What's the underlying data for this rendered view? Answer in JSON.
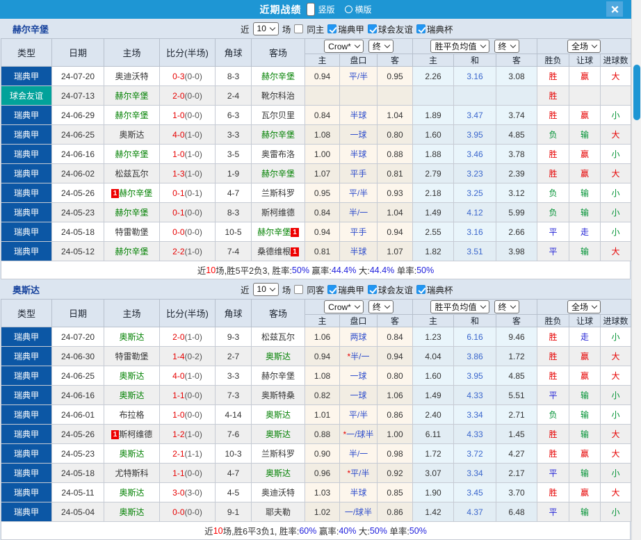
{
  "titlebar": {
    "title": "近期战绩",
    "options": [
      {
        "label": "竖版",
        "selected": true
      },
      {
        "label": "横版",
        "selected": false
      }
    ]
  },
  "colors": {
    "accent_blue": "#1e96d4",
    "league_blue": "#0c57a5",
    "friendly_teal": "#02a29a",
    "win_red": "#e60000",
    "lose_green": "#009233",
    "draw_blue": "#2323d6",
    "focus_team_green": "#008000",
    "handicap_blue": "#2f4ecc"
  },
  "table_header": {
    "main_cols": [
      "类型",
      "日期",
      "主场",
      "比分(半场)",
      "角球",
      "客场"
    ],
    "odds_source_select": "Crow*",
    "odds_final_select": "终",
    "avg_source_select": "胜平负均值",
    "avg_final_select": "终",
    "result_scope_select": "全场",
    "sub_cols": [
      "主",
      "盘口",
      "客",
      "主",
      "和",
      "客",
      "胜负",
      "让球",
      "进球数"
    ]
  },
  "sections": [
    {
      "team": "赫尔辛堡",
      "filter": {
        "near": "近",
        "count": "10",
        "games": "场",
        "same": {
          "label": "同主",
          "checked": false
        },
        "leagues": [
          {
            "label": "瑞典甲",
            "checked": true
          },
          {
            "label": "球会友谊",
            "checked": true
          },
          {
            "label": "瑞典杯",
            "checked": true
          }
        ]
      },
      "rows": [
        {
          "type": "瑞典甲",
          "kind": "league",
          "date": "24-07-20",
          "home": {
            "name": "奥迪沃特",
            "focus": false,
            "card": false
          },
          "score": "0-3",
          "half": "(0-0)",
          "corners": "8-3",
          "away": {
            "name": "赫尔辛堡",
            "focus": true,
            "card": false
          },
          "odds": {
            "home": "0.94",
            "handicap": "平/半",
            "away": "0.95",
            "star": false
          },
          "avg": {
            "home": "2.26",
            "draw": "3.16",
            "away": "3.08"
          },
          "result": [
            "胜",
            "赢",
            "大"
          ]
        },
        {
          "type": "球会友谊",
          "kind": "friendly",
          "date": "24-07-13",
          "home": {
            "name": "赫尔辛堡",
            "focus": true,
            "card": false
          },
          "score": "2-0",
          "half": "(0-0)",
          "corners": "2-4",
          "away": {
            "name": "靴尔科治",
            "focus": false,
            "card": false
          },
          "odds": {
            "home": "",
            "handicap": "",
            "away": "",
            "star": false
          },
          "avg": {
            "home": "",
            "draw": "",
            "away": ""
          },
          "result": [
            "胜",
            "",
            ""
          ]
        },
        {
          "type": "瑞典甲",
          "kind": "league",
          "date": "24-06-29",
          "home": {
            "name": "赫尔辛堡",
            "focus": true,
            "card": false
          },
          "score": "1-0",
          "half": "(0-0)",
          "corners": "6-3",
          "away": {
            "name": "瓦尔贝里",
            "focus": false,
            "card": false
          },
          "odds": {
            "home": "0.84",
            "handicap": "半球",
            "away": "1.04",
            "star": false
          },
          "avg": {
            "home": "1.89",
            "draw": "3.47",
            "away": "3.74"
          },
          "result": [
            "胜",
            "赢",
            "小"
          ]
        },
        {
          "type": "瑞典甲",
          "kind": "league",
          "date": "24-06-25",
          "home": {
            "name": "奥斯达",
            "focus": false,
            "card": false
          },
          "score": "4-0",
          "half": "(1-0)",
          "corners": "3-3",
          "away": {
            "name": "赫尔辛堡",
            "focus": true,
            "card": false
          },
          "odds": {
            "home": "1.08",
            "handicap": "一球",
            "away": "0.80",
            "star": false
          },
          "avg": {
            "home": "1.60",
            "draw": "3.95",
            "away": "4.85"
          },
          "result": [
            "负",
            "输",
            "大"
          ]
        },
        {
          "type": "瑞典甲",
          "kind": "league",
          "date": "24-06-16",
          "home": {
            "name": "赫尔辛堡",
            "focus": true,
            "card": false
          },
          "score": "1-0",
          "half": "(1-0)",
          "corners": "3-5",
          "away": {
            "name": "奥雷布洛",
            "focus": false,
            "card": false
          },
          "odds": {
            "home": "1.00",
            "handicap": "半球",
            "away": "0.88",
            "star": false
          },
          "avg": {
            "home": "1.88",
            "draw": "3.46",
            "away": "3.78"
          },
          "result": [
            "胜",
            "赢",
            "小"
          ]
        },
        {
          "type": "瑞典甲",
          "kind": "league",
          "date": "24-06-02",
          "home": {
            "name": "松兹瓦尔",
            "focus": false,
            "card": false
          },
          "score": "1-3",
          "half": "(1-0)",
          "corners": "1-9",
          "away": {
            "name": "赫尔辛堡",
            "focus": true,
            "card": false
          },
          "odds": {
            "home": "1.07",
            "handicap": "平手",
            "away": "0.81",
            "star": false
          },
          "avg": {
            "home": "2.79",
            "draw": "3.23",
            "away": "2.39"
          },
          "result": [
            "胜",
            "赢",
            "大"
          ]
        },
        {
          "type": "瑞典甲",
          "kind": "league",
          "date": "24-05-26",
          "home": {
            "name": "赫尔辛堡",
            "focus": true,
            "card": true
          },
          "score": "0-1",
          "half": "(0-1)",
          "corners": "4-7",
          "away": {
            "name": "兰斯科罗",
            "focus": false,
            "card": false
          },
          "odds": {
            "home": "0.95",
            "handicap": "平/半",
            "away": "0.93",
            "star": false
          },
          "avg": {
            "home": "2.18",
            "draw": "3.25",
            "away": "3.12"
          },
          "result": [
            "负",
            "输",
            "小"
          ]
        },
        {
          "type": "瑞典甲",
          "kind": "league",
          "date": "24-05-23",
          "home": {
            "name": "赫尔辛堡",
            "focus": true,
            "card": false
          },
          "score": "0-1",
          "half": "(0-0)",
          "corners": "8-3",
          "away": {
            "name": "斯柯维德",
            "focus": false,
            "card": false
          },
          "odds": {
            "home": "0.84",
            "handicap": "半/一",
            "away": "1.04",
            "star": false
          },
          "avg": {
            "home": "1.49",
            "draw": "4.12",
            "away": "5.99"
          },
          "result": [
            "负",
            "输",
            "小"
          ]
        },
        {
          "type": "瑞典甲",
          "kind": "league",
          "date": "24-05-18",
          "home": {
            "name": "特雷勒堡",
            "focus": false,
            "card": false
          },
          "score": "0-0",
          "half": "(0-0)",
          "corners": "10-5",
          "away": {
            "name": "赫尔辛堡",
            "focus": true,
            "card": true
          },
          "odds": {
            "home": "0.94",
            "handicap": "平手",
            "away": "0.94",
            "star": false
          },
          "avg": {
            "home": "2.55",
            "draw": "3.16",
            "away": "2.66"
          },
          "result": [
            "平",
            "走",
            "小"
          ]
        },
        {
          "type": "瑞典甲",
          "kind": "league",
          "date": "24-05-12",
          "home": {
            "name": "赫尔辛堡",
            "focus": true,
            "card": false
          },
          "score": "2-2",
          "half": "(1-0)",
          "corners": "7-4",
          "away": {
            "name": "桑德维根",
            "focus": false,
            "card": true
          },
          "odds": {
            "home": "0.81",
            "handicap": "半球",
            "away": "1.07",
            "star": false
          },
          "avg": {
            "home": "1.82",
            "draw": "3.51",
            "away": "3.98"
          },
          "result": [
            "平",
            "输",
            "大"
          ]
        }
      ],
      "summary": [
        {
          "text": "近",
          "color": "dark"
        },
        {
          "text": "10",
          "color": "red"
        },
        {
          "text": "场,胜5平2负3, 胜率:",
          "color": "dark"
        },
        {
          "text": "50%",
          "color": "blue"
        },
        {
          "text": " 赢率:",
          "color": "dark"
        },
        {
          "text": "44.4%",
          "color": "blue"
        },
        {
          "text": " 大:",
          "color": "dark"
        },
        {
          "text": "44.4%",
          "color": "blue"
        },
        {
          "text": " 单率:",
          "color": "dark"
        },
        {
          "text": "50%",
          "color": "blue"
        }
      ]
    },
    {
      "team": "奥斯达",
      "filter": {
        "near": "近",
        "count": "10",
        "games": "场",
        "same": {
          "label": "同客",
          "checked": false
        },
        "leagues": [
          {
            "label": "瑞典甲",
            "checked": true
          },
          {
            "label": "球会友谊",
            "checked": true
          },
          {
            "label": "瑞典杯",
            "checked": true
          }
        ]
      },
      "rows": [
        {
          "type": "瑞典甲",
          "kind": "league",
          "date": "24-07-20",
          "home": {
            "name": "奥斯达",
            "focus": true,
            "card": false
          },
          "score": "2-0",
          "half": "(1-0)",
          "corners": "9-3",
          "away": {
            "name": "松兹瓦尔",
            "focus": false,
            "card": false
          },
          "odds": {
            "home": "1.06",
            "handicap": "两球",
            "away": "0.84",
            "star": false
          },
          "avg": {
            "home": "1.23",
            "draw": "6.16",
            "away": "9.46"
          },
          "result": [
            "胜",
            "走",
            "小"
          ]
        },
        {
          "type": "瑞典甲",
          "kind": "league",
          "date": "24-06-30",
          "home": {
            "name": "特雷勒堡",
            "focus": false,
            "card": false
          },
          "score": "1-4",
          "half": "(0-2)",
          "corners": "2-7",
          "away": {
            "name": "奥斯达",
            "focus": true,
            "card": false
          },
          "odds": {
            "home": "0.94",
            "handicap": "半/一",
            "away": "0.94",
            "star": true
          },
          "avg": {
            "home": "4.04",
            "draw": "3.86",
            "away": "1.72"
          },
          "result": [
            "胜",
            "赢",
            "大"
          ]
        },
        {
          "type": "瑞典甲",
          "kind": "league",
          "date": "24-06-25",
          "home": {
            "name": "奥斯达",
            "focus": true,
            "card": false
          },
          "score": "4-0",
          "half": "(1-0)",
          "corners": "3-3",
          "away": {
            "name": "赫尔辛堡",
            "focus": false,
            "card": false
          },
          "odds": {
            "home": "1.08",
            "handicap": "一球",
            "away": "0.80",
            "star": false
          },
          "avg": {
            "home": "1.60",
            "draw": "3.95",
            "away": "4.85"
          },
          "result": [
            "胜",
            "赢",
            "大"
          ]
        },
        {
          "type": "瑞典甲",
          "kind": "league",
          "date": "24-06-16",
          "home": {
            "name": "奥斯达",
            "focus": true,
            "card": false
          },
          "score": "1-1",
          "half": "(0-0)",
          "corners": "7-3",
          "away": {
            "name": "奥斯特桑",
            "focus": false,
            "card": false
          },
          "odds": {
            "home": "0.82",
            "handicap": "一球",
            "away": "1.06",
            "star": false
          },
          "avg": {
            "home": "1.49",
            "draw": "4.33",
            "away": "5.51"
          },
          "result": [
            "平",
            "输",
            "小"
          ]
        },
        {
          "type": "瑞典甲",
          "kind": "league",
          "date": "24-06-01",
          "home": {
            "name": "布拉格",
            "focus": false,
            "card": false
          },
          "score": "1-0",
          "half": "(0-0)",
          "corners": "4-14",
          "away": {
            "name": "奥斯达",
            "focus": true,
            "card": false
          },
          "odds": {
            "home": "1.01",
            "handicap": "平/半",
            "away": "0.86",
            "star": false
          },
          "avg": {
            "home": "2.40",
            "draw": "3.34",
            "away": "2.71"
          },
          "result": [
            "负",
            "输",
            "小"
          ]
        },
        {
          "type": "瑞典甲",
          "kind": "league",
          "date": "24-05-26",
          "home": {
            "name": "斯柯维德",
            "focus": false,
            "card": true
          },
          "score": "1-2",
          "half": "(1-0)",
          "corners": "7-6",
          "away": {
            "name": "奥斯达",
            "focus": true,
            "card": false
          },
          "odds": {
            "home": "0.88",
            "handicap": "一/球半",
            "away": "1.00",
            "star": true
          },
          "avg": {
            "home": "6.11",
            "draw": "4.33",
            "away": "1.45"
          },
          "result": [
            "胜",
            "输",
            "大"
          ]
        },
        {
          "type": "瑞典甲",
          "kind": "league",
          "date": "24-05-23",
          "home": {
            "name": "奥斯达",
            "focus": true,
            "card": false
          },
          "score": "2-1",
          "half": "(1-1)",
          "corners": "10-3",
          "away": {
            "name": "兰斯科罗",
            "focus": false,
            "card": false
          },
          "odds": {
            "home": "0.90",
            "handicap": "半/一",
            "away": "0.98",
            "star": false
          },
          "avg": {
            "home": "1.72",
            "draw": "3.72",
            "away": "4.27"
          },
          "result": [
            "胜",
            "赢",
            "大"
          ]
        },
        {
          "type": "瑞典甲",
          "kind": "league",
          "date": "24-05-18",
          "home": {
            "name": "尤特斯科",
            "focus": false,
            "card": false
          },
          "score": "1-1",
          "half": "(0-0)",
          "corners": "4-7",
          "away": {
            "name": "奥斯达",
            "focus": true,
            "card": false
          },
          "odds": {
            "home": "0.96",
            "handicap": "平/半",
            "away": "0.92",
            "star": true
          },
          "avg": {
            "home": "3.07",
            "draw": "3.34",
            "away": "2.17"
          },
          "result": [
            "平",
            "输",
            "小"
          ]
        },
        {
          "type": "瑞典甲",
          "kind": "league",
          "date": "24-05-11",
          "home": {
            "name": "奥斯达",
            "focus": true,
            "card": false
          },
          "score": "3-0",
          "half": "(3-0)",
          "corners": "4-5",
          "away": {
            "name": "奥迪沃特",
            "focus": false,
            "card": false
          },
          "odds": {
            "home": "1.03",
            "handicap": "半球",
            "away": "0.85",
            "star": false
          },
          "avg": {
            "home": "1.90",
            "draw": "3.45",
            "away": "3.70"
          },
          "result": [
            "胜",
            "赢",
            "大"
          ]
        },
        {
          "type": "瑞典甲",
          "kind": "league",
          "date": "24-05-04",
          "home": {
            "name": "奥斯达",
            "focus": true,
            "card": false
          },
          "score": "0-0",
          "half": "(0-0)",
          "corners": "9-1",
          "away": {
            "name": "耶夫勒",
            "focus": false,
            "card": false
          },
          "odds": {
            "home": "1.02",
            "handicap": "一/球半",
            "away": "0.86",
            "star": false
          },
          "avg": {
            "home": "1.42",
            "draw": "4.37",
            "away": "6.48"
          },
          "result": [
            "平",
            "输",
            "小"
          ]
        }
      ],
      "summary": [
        {
          "text": "近",
          "color": "dark"
        },
        {
          "text": "10",
          "color": "red"
        },
        {
          "text": "场,胜6平3负1, 胜率:",
          "color": "dark"
        },
        {
          "text": "60%",
          "color": "blue"
        },
        {
          "text": " 赢率:",
          "color": "dark"
        },
        {
          "text": "40%",
          "color": "blue"
        },
        {
          "text": " 大:",
          "color": "dark"
        },
        {
          "text": "50%",
          "color": "blue"
        },
        {
          "text": " 单率:",
          "color": "dark"
        },
        {
          "text": "50%",
          "color": "blue"
        }
      ]
    }
  ]
}
